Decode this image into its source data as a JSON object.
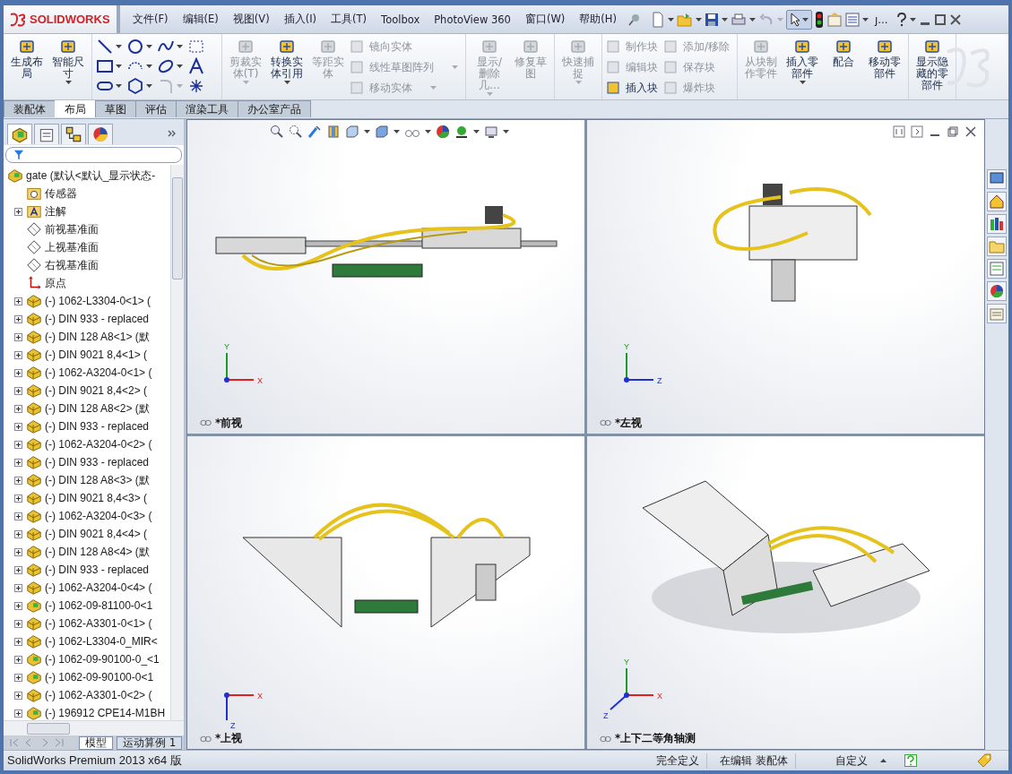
{
  "title_bar": {
    "logo": "SOLIDWORKS",
    "menus": [
      "文件(F)",
      "编辑(E)",
      "视图(V)",
      "插入(I)",
      "工具(T)",
      "Toolbox",
      "PhotoView 360",
      "窗口(W)",
      "帮助(H)"
    ],
    "search_stub": "ȷ..."
  },
  "ribbon": {
    "groups": [
      {
        "items": [
          {
            "kind": "large",
            "label": "生成布局",
            "disabled": false,
            "dropdown": false
          },
          {
            "kind": "large",
            "label": "智能尺寸",
            "disabled": false,
            "dropdown": true
          }
        ]
      },
      {
        "items": [
          {
            "kind": "sketch_tools"
          }
        ]
      },
      {
        "items": [
          {
            "kind": "large",
            "label": "剪裁实体(T)",
            "disabled": true,
            "dropdown": true
          },
          {
            "kind": "large",
            "label": "转换实体引用",
            "disabled": false,
            "dropdown": true
          },
          {
            "kind": "large",
            "label": "等距实体",
            "disabled": true,
            "dropdown": false
          },
          {
            "kind": "stack",
            "items": [
              {
                "label": "镜向实体",
                "disabled": true,
                "dropdown": false
              },
              {
                "label": "线性草图阵列",
                "disabled": true,
                "dropdown": true
              },
              {
                "label": "移动实体",
                "disabled": true,
                "dropdown": true
              }
            ]
          }
        ]
      },
      {
        "items": [
          {
            "kind": "large",
            "label": "显示/删除几…",
            "disabled": true,
            "dropdown": true
          },
          {
            "kind": "large",
            "label": "修复草图",
            "disabled": true,
            "dropdown": false
          }
        ]
      },
      {
        "items": [
          {
            "kind": "large",
            "label": "快速捕捉",
            "disabled": true,
            "dropdown": true
          }
        ]
      },
      {
        "items": [
          {
            "kind": "stack",
            "items": [
              {
                "label": "制作块",
                "disabled": true,
                "dropdown": false
              },
              {
                "label": "编辑块",
                "disabled": true,
                "dropdown": false
              },
              {
                "label": "插入块",
                "disabled": false,
                "dropdown": false
              }
            ]
          },
          {
            "kind": "stack",
            "items": [
              {
                "label": "添加/移除",
                "disabled": true,
                "dropdown": false
              },
              {
                "label": "保存块",
                "disabled": true,
                "dropdown": false
              },
              {
                "label": "爆炸块",
                "disabled": true,
                "dropdown": false
              }
            ]
          }
        ]
      },
      {
        "items": [
          {
            "kind": "large",
            "label": "从块制作零件",
            "disabled": true,
            "dropdown": false
          },
          {
            "kind": "large",
            "label": "插入零部件",
            "disabled": false,
            "dropdown": true
          },
          {
            "kind": "large",
            "label": "配合",
            "disabled": false,
            "dropdown": false
          },
          {
            "kind": "large",
            "label": "移动零部件",
            "disabled": false,
            "dropdown": false
          }
        ]
      },
      {
        "items": [
          {
            "kind": "large",
            "label": "显示隐藏的零部件",
            "disabled": false,
            "dropdown": false
          }
        ]
      }
    ]
  },
  "tabs": [
    {
      "label": "装配体",
      "selected": false
    },
    {
      "label": "布局",
      "selected": true
    },
    {
      "label": "草图",
      "selected": false
    },
    {
      "label": "评估",
      "selected": false
    },
    {
      "label": "渲染工具",
      "selected": false
    },
    {
      "label": "办公室产品",
      "selected": false
    }
  ],
  "feature_tree": {
    "root": "gate  (默认<默认_显示状态-",
    "items": [
      {
        "kind": "sensor",
        "label": "传感器"
      },
      {
        "kind": "annotation",
        "label": "注解",
        "expanded": false
      },
      {
        "kind": "plane",
        "label": "前视基准面"
      },
      {
        "kind": "plane",
        "label": "上视基准面"
      },
      {
        "kind": "plane",
        "label": "右视基准面"
      },
      {
        "kind": "origin",
        "label": "原点"
      },
      {
        "kind": "part",
        "label": "(-) 1062-L3304-0<1> (",
        "expanded": false
      },
      {
        "kind": "part",
        "label": "(-) DIN 933 - replaced",
        "expanded": false
      },
      {
        "kind": "part",
        "label": "(-) DIN 128 A8<1> (默",
        "expanded": false
      },
      {
        "kind": "part",
        "label": "(-) DIN 9021 8,4<1> (",
        "expanded": false
      },
      {
        "kind": "part",
        "label": "(-) 1062-A3204-0<1> (",
        "expanded": false
      },
      {
        "kind": "part",
        "label": "(-) DIN 9021 8,4<2> (",
        "expanded": false
      },
      {
        "kind": "part",
        "label": "(-) DIN 128 A8<2> (默",
        "expanded": false
      },
      {
        "kind": "part",
        "label": "(-) DIN 933 - replaced",
        "expanded": false
      },
      {
        "kind": "part",
        "label": "(-) 1062-A3204-0<2> (",
        "expanded": false
      },
      {
        "kind": "part",
        "label": "(-) DIN 933 - replaced",
        "expanded": false
      },
      {
        "kind": "part",
        "label": "(-) DIN 128 A8<3> (默",
        "expanded": false
      },
      {
        "kind": "part",
        "label": "(-) DIN 9021 8,4<3> (",
        "expanded": false
      },
      {
        "kind": "part",
        "label": "(-) 1062-A3204-0<3> (",
        "expanded": false
      },
      {
        "kind": "part",
        "label": "(-) DIN 9021 8,4<4> (",
        "expanded": false
      },
      {
        "kind": "part",
        "label": "(-) DIN 128 A8<4> (默",
        "expanded": false
      },
      {
        "kind": "part",
        "label": "(-) DIN 933 - replaced",
        "expanded": false
      },
      {
        "kind": "part",
        "label": "(-) 1062-A3204-0<4> (",
        "expanded": false
      },
      {
        "kind": "assembly",
        "label": "(-) 1062-09-81100-0<1",
        "expanded": false
      },
      {
        "kind": "part",
        "label": "(-) 1062-A3301-0<1> (",
        "expanded": false
      },
      {
        "kind": "part",
        "label": "(-) 1062-L3304-0_MIR<",
        "expanded": false
      },
      {
        "kind": "assembly",
        "label": "(-) 1062-09-90100-0_<1",
        "expanded": false
      },
      {
        "kind": "assembly",
        "label": "(-) 1062-09-90100-0<1",
        "expanded": false
      },
      {
        "kind": "part",
        "label": "(-) 1062-A3301-0<2> (",
        "expanded": false
      },
      {
        "kind": "assembly",
        "label": "(-) 196912 CPE14-M1BH",
        "expanded": false
      }
    ]
  },
  "bottom_tabs": [
    {
      "label": "模型",
      "selected": true
    },
    {
      "label": "运动算例 1",
      "selected": false
    }
  ],
  "viewports": [
    {
      "kind": "front",
      "label": "*前视",
      "triad": [
        {
          "label": "Y",
          "color": "#1f9a2a"
        },
        {
          "label": "X",
          "color": "#e02020"
        }
      ]
    },
    {
      "kind": "left",
      "label": "*左视",
      "triad": [
        {
          "label": "Y",
          "color": "#1f9a2a"
        },
        {
          "label": "Z",
          "color": "#2030d0"
        }
      ]
    },
    {
      "kind": "top",
      "label": "*上视",
      "triad": [
        {
          "label": "X",
          "color": "#e02020"
        },
        {
          "label": "Z",
          "color": "#2030d0"
        }
      ]
    },
    {
      "kind": "iso",
      "label": "*上下二等角轴测",
      "triad": [
        {
          "label": "Y",
          "color": "#1f9a2a"
        },
        {
          "label": "X",
          "color": "#e02020"
        },
        {
          "label": "Z",
          "color": "#2030d0"
        }
      ]
    }
  ],
  "status_bar": {
    "product": "SolidWorks Premium 2013 x64 版",
    "state": "完全定义",
    "mode": "在编辑 装配体",
    "units": "自定义"
  }
}
